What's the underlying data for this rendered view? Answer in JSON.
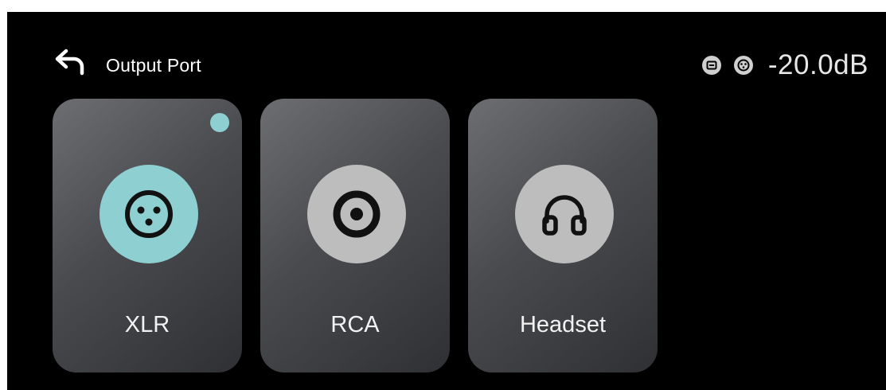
{
  "header": {
    "title": "Output Port",
    "back_icon": "back-arrow-icon",
    "status_icons": [
      "rca-port-icon",
      "xlr-port-icon"
    ],
    "volume": "-20.0dB"
  },
  "ports": [
    {
      "label": "XLR",
      "icon": "xlr-connector-icon",
      "selected": true
    },
    {
      "label": "RCA",
      "icon": "rca-connector-icon",
      "selected": false
    },
    {
      "label": "Headset",
      "icon": "headphones-icon",
      "selected": false
    }
  ],
  "colors": {
    "background": "#000000",
    "accent": "#8ecfd1",
    "inactive_circle": "#bdbdbd",
    "icon_stroke": "#111111",
    "text": "#f2f2f2"
  }
}
